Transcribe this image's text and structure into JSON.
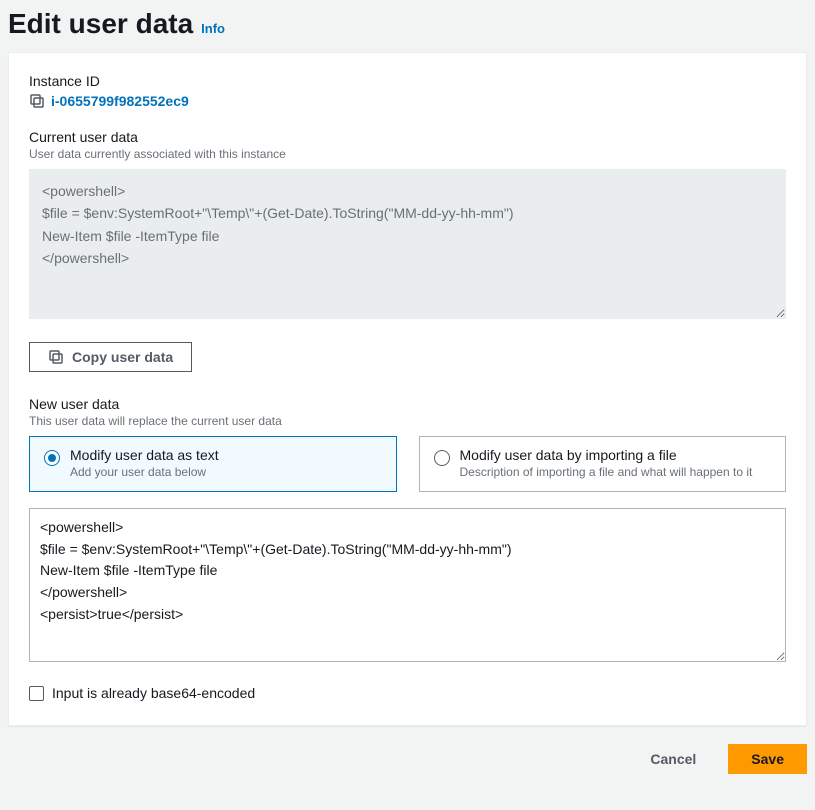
{
  "header": {
    "title": "Edit user data",
    "info_label": "Info"
  },
  "instance": {
    "label": "Instance ID",
    "id": "i-0655799f982552ec9"
  },
  "current": {
    "label": "Current user data",
    "desc": "User data currently associated with this instance",
    "value": "<powershell>\n$file = $env:SystemRoot+\"\\Temp\\\"+(Get-Date).ToString(\"MM-dd-yy-hh-mm\")\nNew-Item $file -ItemType file\n</powershell>"
  },
  "copy_button_label": "Copy user data",
  "new": {
    "label": "New user data",
    "desc": "This user data will replace the current user data",
    "options": {
      "text": {
        "title": "Modify user data as text",
        "desc": "Add your user data below",
        "selected": true
      },
      "file": {
        "title": "Modify user data by importing a file",
        "desc": "Description of importing a file and what will happen to it",
        "selected": false
      }
    },
    "value": "<powershell>\n$file = $env:SystemRoot+\"\\Temp\\\"+(Get-Date).ToString(\"MM-dd-yy-hh-mm\")\nNew-Item $file -ItemType file\n</powershell>\n<persist>true</persist>"
  },
  "base64": {
    "label": "Input is already base64-encoded",
    "checked": false
  },
  "footer": {
    "cancel": "Cancel",
    "save": "Save"
  },
  "colors": {
    "accent": "#0073bb",
    "primary_button": "#ff9900",
    "page_bg": "#f2f3f3"
  }
}
